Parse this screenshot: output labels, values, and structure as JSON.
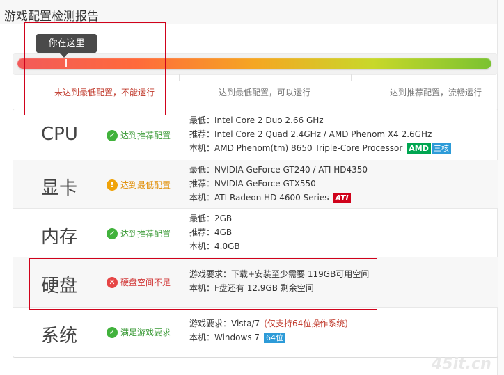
{
  "page": {
    "title": "游戏配置检测报告"
  },
  "level": {
    "tooltip": "你在这里",
    "labels": {
      "low": "未达到最低配置，不能运行",
      "min": "达到最低配置，可以运行",
      "rec": "达到推荐配置，流畅运行"
    },
    "position": 0.1
  },
  "rows": [
    {
      "name": "CPU",
      "status": "达到推荐配置",
      "status_type": "ok",
      "lines": [
        "最低：Intel Core 2 Duo 2.66 GHz",
        "推荐：Intel Core 2 Quad 2.4GHz / AMD Phenom X4 2.6GHz",
        "本机：AMD Phenom(tm) 8650 Triple-Core Processor"
      ],
      "badges": [
        "AMD",
        "三核"
      ]
    },
    {
      "name": "显卡",
      "status": "达到最低配置",
      "status_type": "warn",
      "lines": [
        "最低：NVIDIA GeForce GT240 / ATI HD4350",
        "推荐：NVIDIA GeForce GTX550",
        "本机：ATI Radeon HD 4600 Series"
      ],
      "badges": [
        "ATI"
      ]
    },
    {
      "name": "内存",
      "status": "达到推荐配置",
      "status_type": "ok",
      "lines": [
        "最低：2GB",
        "推荐：4GB",
        "本机：4.0GB"
      ]
    },
    {
      "name": "硬盘",
      "status": "硬盘空间不足",
      "status_type": "bad",
      "lines": [
        "游戏要求：下载+安装至少需要 119GB可用空间",
        "本机：F盘还有 12.9GB 剩余空间"
      ]
    },
    {
      "name": "系统",
      "status": "满足游戏要求",
      "status_type": "ok",
      "lines": [
        "游戏要求：Vista/7",
        "本机：Windows 7"
      ],
      "note": "(仅支持64位操作系统)",
      "badges": [
        "64位"
      ]
    }
  ],
  "watermark": "45it.cn",
  "colors": {
    "ok": "#41b23c",
    "warn": "#f0a30a",
    "bad": "#e64545",
    "highlight": "#d0021b"
  }
}
